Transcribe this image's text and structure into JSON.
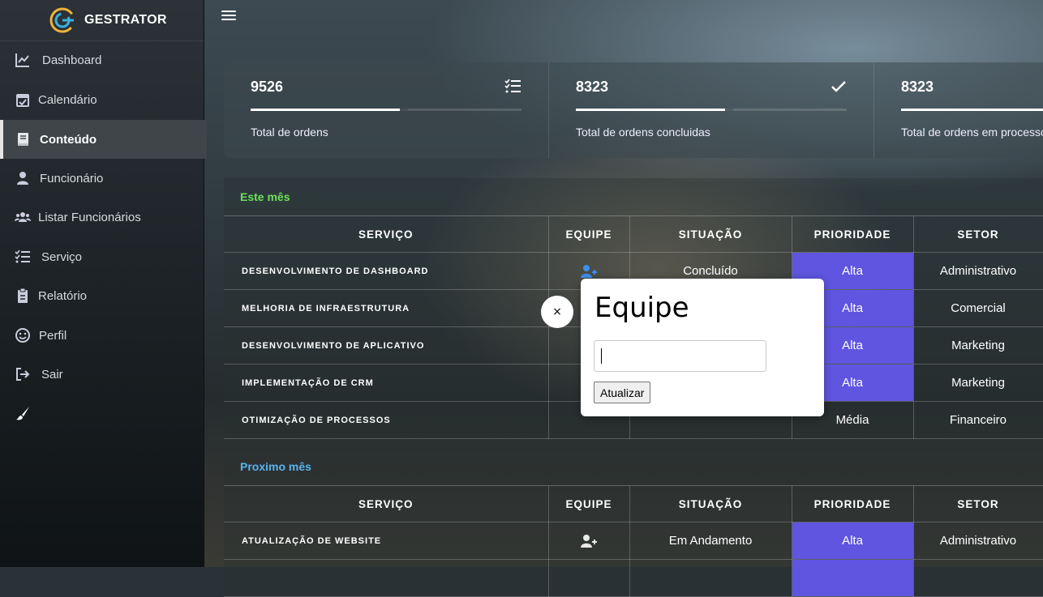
{
  "app": {
    "brand": "GESTRATOR"
  },
  "sidebar": {
    "items": [
      {
        "label": "Dashboard",
        "icon": "chart-line-icon"
      },
      {
        "label": "Calendário",
        "icon": "calendar-check-icon"
      },
      {
        "label": "Conteúdo",
        "icon": "book-icon",
        "active": true
      },
      {
        "label": "Funcionário",
        "icon": "user-icon"
      },
      {
        "label": "Listar Funcionários",
        "icon": "users-icon"
      },
      {
        "label": "Serviço",
        "icon": "tasks-icon"
      },
      {
        "label": "Relatório",
        "icon": "clipboard-icon"
      },
      {
        "label": "Perfil",
        "icon": "smile-icon"
      },
      {
        "label": "Sair",
        "icon": "sign-out-icon"
      },
      {
        "label": "",
        "icon": "brush-icon"
      }
    ]
  },
  "stats": [
    {
      "value": "9526",
      "caption": "Total de ordens",
      "icon": "tasks-icon",
      "progress": 0.55
    },
    {
      "value": "8323",
      "caption": "Total de ordens concluidas",
      "icon": "check-icon",
      "progress": 0.55
    },
    {
      "value": "8323",
      "caption": "Total de ordens em processo",
      "icon": "",
      "progress": 0.55
    }
  ],
  "this_month": {
    "title": "Este mês",
    "title_color": "#6ee05a",
    "headers": [
      "SERVIÇO",
      "EQUIPE",
      "SITUAÇÃO",
      "PRIORIDADE",
      "SETOR"
    ],
    "rows": [
      {
        "service": "DESENVOLVIMENTO DE DASHBOARD",
        "status": "Concluído",
        "priority": "Alta",
        "sector": "Administrativo"
      },
      {
        "service": "MELHORIA DE INFRAESTRUTURA",
        "status": "",
        "priority": "Alta",
        "sector": "Comercial"
      },
      {
        "service": "DESENVOLVIMENTO DE APLICATIVO",
        "status": "",
        "priority": "Alta",
        "sector": "Marketing"
      },
      {
        "service": "IMPLEMENTAÇÃO DE CRM",
        "status": "",
        "priority": "Alta",
        "sector": "Marketing"
      },
      {
        "service": "OTIMIZAÇÃO DE PROCESSOS",
        "status": "",
        "priority": "Média",
        "sector": "Financeiro"
      }
    ]
  },
  "next_month": {
    "title": "Proximo mês",
    "title_color": "#5ab4f0",
    "headers": [
      "SERVIÇO",
      "EQUIPE",
      "SITUAÇÃO",
      "PRIORIDADE",
      "SETOR"
    ],
    "rows": [
      {
        "service": "ATUALIZAÇÃO DE WEBSITE",
        "status": "Em Andamento",
        "priority": "Alta",
        "sector": "Administrativo"
      },
      {
        "service": "",
        "status": "",
        "priority": "",
        "sector": ""
      }
    ]
  },
  "modal": {
    "title": "Equipe",
    "input_value": "",
    "button_label": "Atualizar",
    "close_label": "×"
  },
  "colors": {
    "priority_high": "#5f55e0",
    "team_icon_active": "#3b8ef0"
  }
}
